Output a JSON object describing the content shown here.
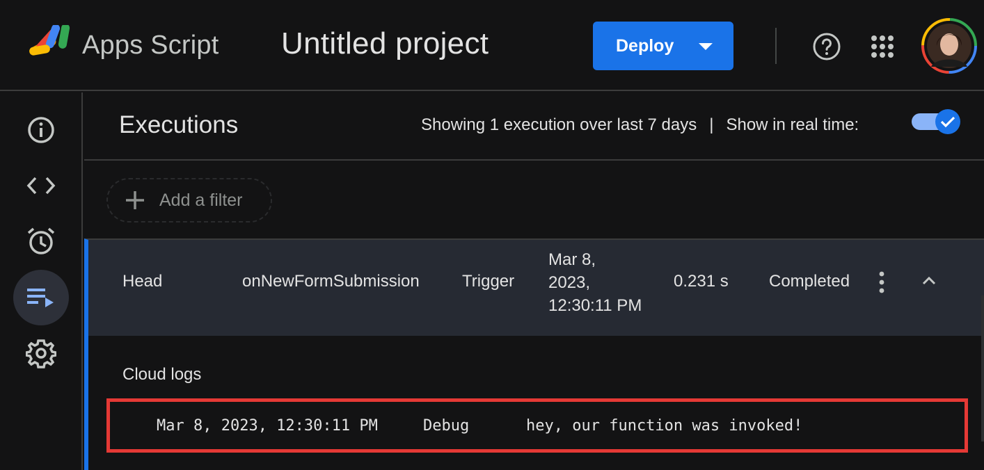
{
  "header": {
    "brand": "Apps Script",
    "project_title": "Untitled project",
    "deploy_label": "Deploy",
    "icons": {
      "help": "help-circle-icon",
      "apps": "apps-grid-icon",
      "avatar": "user-avatar"
    }
  },
  "rail": {
    "items": [
      {
        "name": "overview",
        "icon": "info-icon"
      },
      {
        "name": "editor",
        "icon": "code-icon"
      },
      {
        "name": "triggers",
        "icon": "alarm-icon"
      },
      {
        "name": "executions",
        "icon": "executions-icon",
        "active": true
      },
      {
        "name": "settings",
        "icon": "gear-icon"
      }
    ]
  },
  "executions": {
    "title": "Executions",
    "summary": "Showing 1 execution over last 7 days",
    "separator": "|",
    "realtime_label": "Show in real time:",
    "realtime_on": true,
    "filter_label": "Add a filter",
    "row": {
      "deployment": "Head",
      "function": "onNewFormSubmission",
      "type": "Trigger",
      "date_line1": "Mar 8,",
      "date_line2": "2023,",
      "date_line3": "12:30:11 PM",
      "duration": "0.231 s",
      "status": "Completed"
    },
    "cloud_logs_title": "Cloud logs",
    "log": {
      "timestamp": "Mar 8, 2023, 12:30:11 PM",
      "severity": "Debug",
      "message": "hey, our function was invoked!"
    }
  },
  "colors": {
    "background": "#131314",
    "accent": "#1a73e8",
    "row_bg": "#262a33",
    "highlight_box": "#e53935"
  }
}
